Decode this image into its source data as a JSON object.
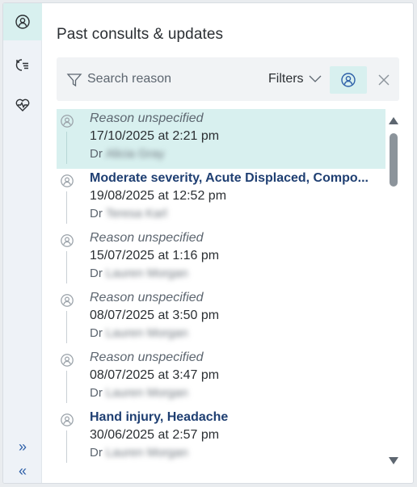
{
  "panel": {
    "title": "Past consults & updates"
  },
  "search": {
    "placeholder": "Search reason",
    "filters_label": "Filters"
  },
  "consults": [
    {
      "reason": "Reason unspecified",
      "reason_style": "unspecified",
      "datetime": "17/10/2025 at 2:21 pm",
      "doctor_prefix": "Dr",
      "doctor_name": "Alicia Gray",
      "selected": true
    },
    {
      "reason": "Moderate severity, Acute Displaced, Compo...",
      "reason_style": "named",
      "datetime": "19/08/2025 at 12:52 pm",
      "doctor_prefix": "Dr",
      "doctor_name": "Teresa Karl",
      "selected": false
    },
    {
      "reason": "Reason unspecified",
      "reason_style": "unspecified",
      "datetime": "15/07/2025 at 1:16 pm",
      "doctor_prefix": "Dr",
      "doctor_name": "Lauren Morgan",
      "selected": false
    },
    {
      "reason": "Reason unspecified",
      "reason_style": "unspecified",
      "datetime": "08/07/2025 at 3:50 pm",
      "doctor_prefix": "Dr",
      "doctor_name": "Lauren Morgan",
      "selected": false
    },
    {
      "reason": "Reason unspecified",
      "reason_style": "unspecified",
      "datetime": "08/07/2025 at 3:47 pm",
      "doctor_prefix": "Dr",
      "doctor_name": "Lauren Morgan",
      "selected": false
    },
    {
      "reason": "Hand injury, Headache",
      "reason_style": "named",
      "datetime": "30/06/2025 at 2:57 pm",
      "doctor_prefix": "Dr",
      "doctor_name": "Lauren Morgan",
      "selected": false
    }
  ],
  "rail": {
    "items": [
      {
        "icon": "consult-icon",
        "active": true
      },
      {
        "icon": "history-list-icon",
        "active": false
      },
      {
        "icon": "heart-monitor-icon",
        "active": false
      }
    ],
    "bottom": [
      {
        "icon": "expand-right-icon",
        "glyph": "»"
      },
      {
        "icon": "collapse-left-icon",
        "glyph": "«"
      }
    ]
  },
  "colors": {
    "accent_teal": "#d8f0ef",
    "link_blue": "#1f3f72",
    "rail_blue": "#2d5fa8"
  }
}
